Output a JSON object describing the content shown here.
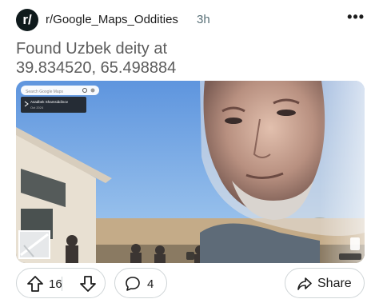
{
  "post": {
    "subreddit": "r/Google_Maps_Oddities",
    "subreddit_icon": "r/",
    "age": "3h",
    "menu_label": "•••",
    "title_line1": "Found Uzbek deity at",
    "title_line2": "39.834520, 65.498884"
  },
  "streetview": {
    "search_placeholder": "Search Google Maps",
    "location_name": "Asadbek Shamsiddinov",
    "location_date": "Oct 2024"
  },
  "actions": {
    "upvote_icon": "upvote-arrow-icon",
    "vote_count": "16",
    "downvote_icon": "downvote-arrow-icon",
    "comment_icon": "comment-bubble-icon",
    "comment_count": "4",
    "share_icon": "share-arrow-icon",
    "share_label": "Share"
  },
  "colors": {
    "sky": "#7fb2ea",
    "icon_bg": "#0f1a1c",
    "border": "#cfd5d7",
    "meta_text": "#576f76"
  }
}
